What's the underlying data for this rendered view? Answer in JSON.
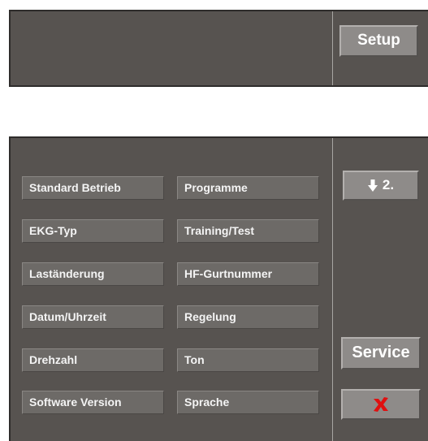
{
  "header": {
    "setup_label": "Setup"
  },
  "menu": {
    "left": [
      {
        "label": "Standard Betrieb"
      },
      {
        "label": "EKG-Typ"
      },
      {
        "label": "Laständerung"
      },
      {
        "label": "Datum/Uhrzeit"
      },
      {
        "label": "Drehzahl"
      },
      {
        "label": "Software Version"
      }
    ],
    "right": [
      {
        "label": "Programme"
      },
      {
        "label": "Training/Test"
      },
      {
        "label": "HF-Gurtnummer"
      },
      {
        "label": "Regelung"
      },
      {
        "label": "Ton"
      },
      {
        "label": "Sprache"
      }
    ]
  },
  "side": {
    "next_page_label": "2.",
    "next_page_icon": "arrow-down-icon",
    "service_label": "Service",
    "cancel_icon": "red-x-icon"
  },
  "colors": {
    "panel": "#575350",
    "button": "#6d6a67",
    "side_button": "#8e8b89",
    "cancel_x": "#e01010"
  }
}
